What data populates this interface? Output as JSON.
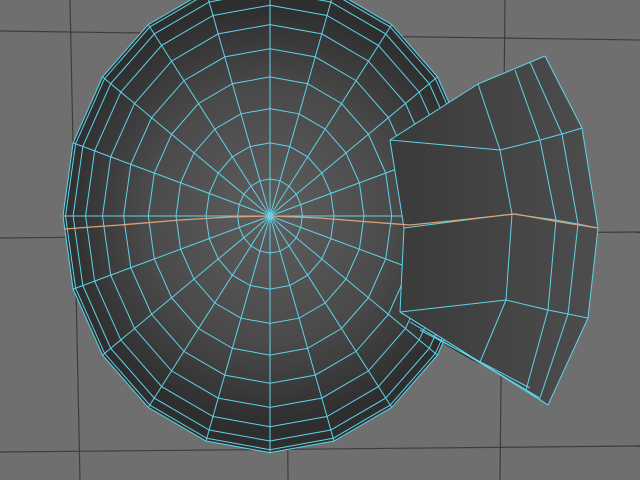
{
  "viewport": {
    "background_color": "#6f6f6f",
    "grid_color": "#3d3d3d",
    "wireframe_color": "#5fd3e8",
    "selected_edge_color": "#d8a37a",
    "mesh_fill_dark": "#333333",
    "mesh_fill_light": "#5c5c5c",
    "camera": "top",
    "display_mode": "wireframe-on-shaded"
  },
  "mesh": {
    "sphere": {
      "pole": "top",
      "latitude_rings": 10,
      "longitude_segments": 20
    },
    "extruded_face_group": {
      "visible": true
    },
    "selected_edge_loop": {
      "visible": true
    }
  }
}
